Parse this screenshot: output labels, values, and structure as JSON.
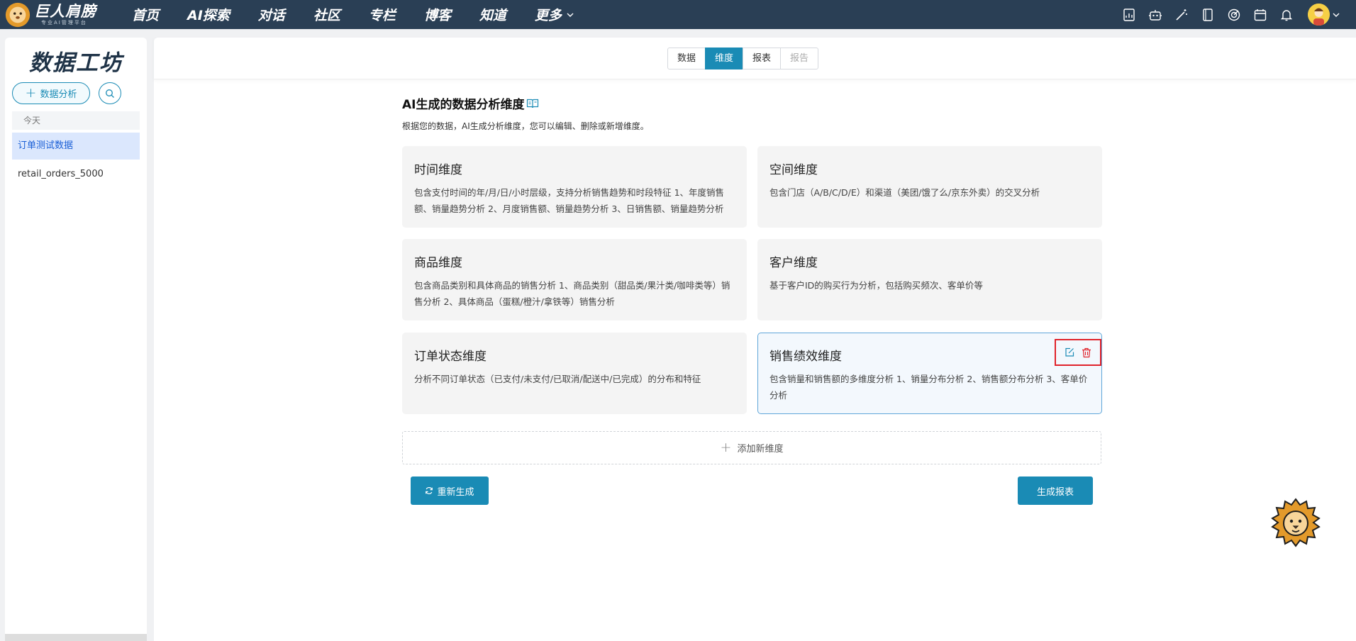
{
  "brand": {
    "name": "巨人肩膀",
    "tagline": "专业AI管理平台"
  },
  "nav": {
    "items": [
      "首页",
      "AI探索",
      "对话",
      "社区",
      "专栏",
      "博客",
      "知道"
    ],
    "more_label": "更多"
  },
  "nav_icons": [
    "report-icon",
    "robot-icon",
    "magic-wand-icon",
    "notebook-icon",
    "target-icon",
    "calendar-icon",
    "bell-icon"
  ],
  "sidebar": {
    "title": "数据工坊",
    "new_analysis_label": "数据分析",
    "section_label": "今天",
    "items": [
      {
        "label": "订单测试数据",
        "active": true
      },
      {
        "label": "retail_orders_5000",
        "active": false
      }
    ]
  },
  "tabs": [
    {
      "label": "数据",
      "state": "normal"
    },
    {
      "label": "维度",
      "state": "active"
    },
    {
      "label": "报表",
      "state": "normal"
    },
    {
      "label": "报告",
      "state": "disabled"
    }
  ],
  "main": {
    "heading": "AI生成的数据分析维度",
    "description": "根据您的数据，AI生成分析维度，您可以编辑、删除或新增维度。",
    "add_dimension_label": "添加新维度",
    "regenerate_label": "重新生成",
    "generate_report_label": "生成报表"
  },
  "dimensions": [
    {
      "title": "时间维度",
      "body": "包含支付时间的年/月/日/小时层级，支持分析销售趋势和时段特征 1、年度销售额、销量趋势分析 2、月度销售额、销量趋势分析 3、日销售额、销量趋势分析",
      "selected": false
    },
    {
      "title": "空间维度",
      "body": "包含门店（A/B/C/D/E）和渠道（美团/饿了么/京东外卖）的交叉分析",
      "selected": false
    },
    {
      "title": "商品维度",
      "body": "包含商品类别和具体商品的销售分析 1、商品类别（甜品类/果汁类/咖啡类等）销售分析 2、具体商品（蛋糕/橙汁/拿铁等）销售分析",
      "selected": false
    },
    {
      "title": "客户维度",
      "body": "基于客户ID的购买行为分析，包括购买频次、客单价等",
      "selected": false
    },
    {
      "title": "订单状态维度",
      "body": "分析不同订单状态（已支付/未支付/已取消/配送中/已完成）的分布和特征",
      "selected": false
    },
    {
      "title": "销售绩效维度",
      "body": "包含销量和销售额的多维度分析 1、销量分布分析 2、销售额分布分析 3、客单价分析",
      "selected": true
    }
  ],
  "colors": {
    "accent": "#1a8bb5",
    "topbar": "#2a3f55",
    "delete": "#e0232b"
  }
}
